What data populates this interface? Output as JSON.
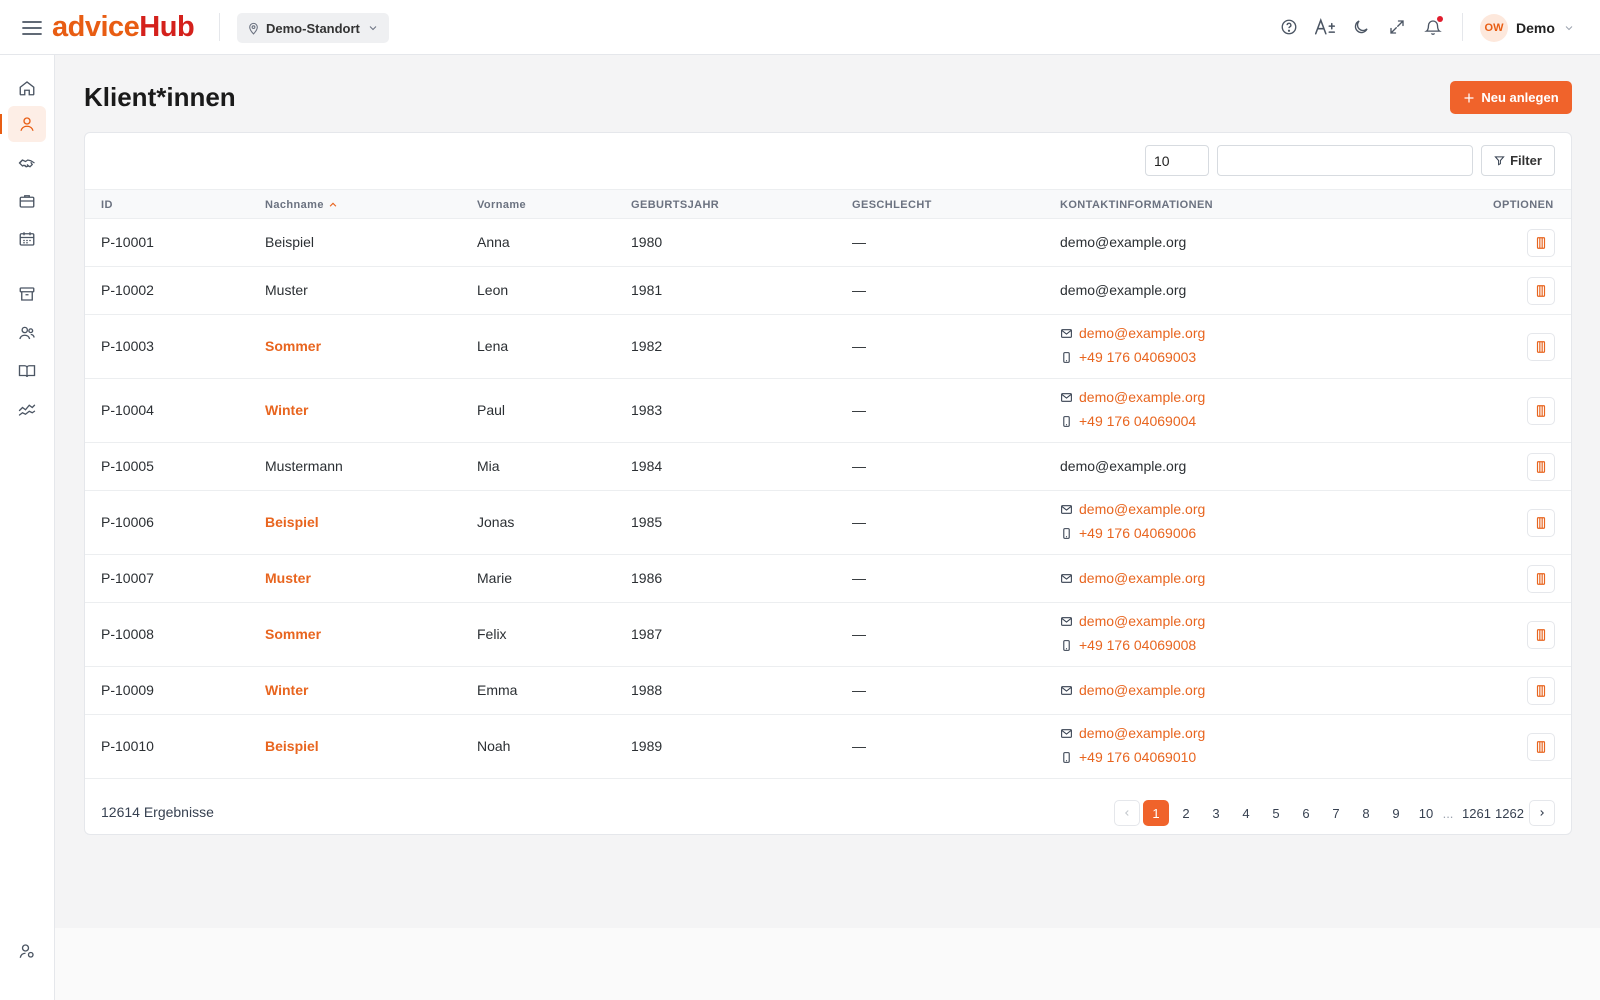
{
  "header": {
    "logo_part1": "advice",
    "logo_part2": "Hub",
    "location": "Demo-Standort",
    "user_initials": "OW",
    "user_name": "Demo"
  },
  "page": {
    "title": "Klient*innen",
    "new_button": "Neu anlegen"
  },
  "toolbar": {
    "page_size": "10",
    "search_value": "",
    "filter_label": "Filter"
  },
  "table": {
    "columns": [
      "ID",
      "Nachname",
      "Vorname",
      "GEBURTSJAHR",
      "GESCHLECHT",
      "KONTAKTINFORMATIONEN",
      "OPTIONEN"
    ],
    "sort_column": "Nachname",
    "sort_direction": "ascending",
    "rows": [
      {
        "id": "P-10001",
        "lastname": "Beispiel",
        "firstname": "Anna",
        "year": "1980",
        "gender": "—",
        "email": "demo@example.org",
        "phone": "",
        "linked": false
      },
      {
        "id": "P-10002",
        "lastname": "Muster",
        "firstname": "Leon",
        "year": "1981",
        "gender": "—",
        "email": "demo@example.org",
        "phone": "",
        "linked": false
      },
      {
        "id": "P-10003",
        "lastname": "Sommer",
        "firstname": "Lena",
        "year": "1982",
        "gender": "—",
        "email": "demo@example.org",
        "phone": "+49 176 04069003",
        "linked": true
      },
      {
        "id": "P-10004",
        "lastname": "Winter",
        "firstname": "Paul",
        "year": "1983",
        "gender": "—",
        "email": "demo@example.org",
        "phone": "+49 176 04069004",
        "linked": true
      },
      {
        "id": "P-10005",
        "lastname": "Mustermann",
        "firstname": "Mia",
        "year": "1984",
        "gender": "—",
        "email": "demo@example.org",
        "phone": "",
        "linked": false
      },
      {
        "id": "P-10006",
        "lastname": "Beispiel",
        "firstname": "Jonas",
        "year": "1985",
        "gender": "—",
        "email": "demo@example.org",
        "phone": "+49 176 04069006",
        "linked": true
      },
      {
        "id": "P-10007",
        "lastname": "Muster",
        "firstname": "Marie",
        "year": "1986",
        "gender": "—",
        "email": "demo@example.org",
        "phone": "",
        "linked": true
      },
      {
        "id": "P-10008",
        "lastname": "Sommer",
        "firstname": "Felix",
        "year": "1987",
        "gender": "—",
        "email": "demo@example.org",
        "phone": "+49 176 04069008",
        "linked": true
      },
      {
        "id": "P-10009",
        "lastname": "Winter",
        "firstname": "Emma",
        "year": "1988",
        "gender": "—",
        "email": "demo@example.org",
        "phone": "",
        "linked": true
      },
      {
        "id": "P-10010",
        "lastname": "Beispiel",
        "firstname": "Noah",
        "year": "1989",
        "gender": "—",
        "email": "demo@example.org",
        "phone": "+49 176 04069010",
        "linked": true
      }
    ]
  },
  "footer": {
    "results": "12614 Ergebnisse",
    "pages": [
      "1",
      "2",
      "3",
      "4",
      "5",
      "6",
      "7",
      "8",
      "9",
      "10",
      "...",
      "1261",
      "1262"
    ],
    "current_page": "1"
  },
  "colors": {
    "accent": "#f0632b",
    "link": "#e8651f",
    "logo_red": "#d4211c"
  },
  "icons": {
    "sidebar": [
      "home-icon",
      "user-icon",
      "handshake-icon",
      "briefcase-icon",
      "calendar-icon",
      "archive-icon",
      "users-icon",
      "book-icon",
      "chart-icon",
      "user-settings-icon"
    ],
    "topbar": [
      "help-icon",
      "font-size-icon",
      "dark-mode-icon",
      "fullscreen-icon",
      "bell-icon"
    ]
  }
}
